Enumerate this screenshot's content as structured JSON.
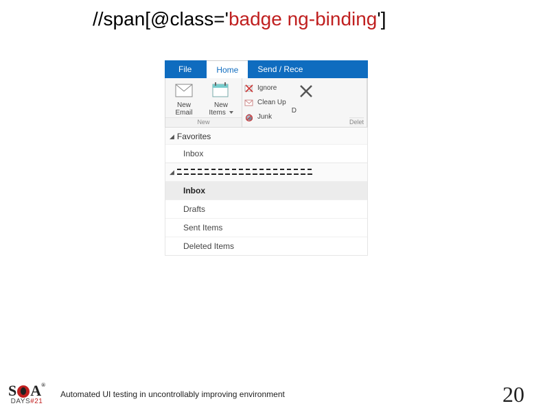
{
  "title": {
    "part1": "//span[@class='",
    "part2": "badge ng-binding",
    "part3": "']"
  },
  "outlook": {
    "tabs": {
      "file": "File",
      "home": "Home",
      "sendrecv": "Send / Rece"
    },
    "new_group": {
      "label": "New",
      "new_email": "New\nEmail",
      "new_items": "New\nItems "
    },
    "delete_group": {
      "label": "Delet",
      "ignore": "Ignore",
      "cleanup": "Clean Up ",
      "junk": "Junk ",
      "delete_trunc": "D"
    },
    "nav": {
      "favorites": "Favorites",
      "inbox_fav": "Inbox",
      "inbox": "Inbox",
      "drafts": "Drafts",
      "sent": "Sent Items",
      "deleted": "Deleted Items"
    }
  },
  "footer": {
    "logo_top_s": "S",
    "logo_top_a": "A",
    "logo_bottom_days": "DAYS",
    "logo_bottom_hash": "#21",
    "caption": "Automated UI testing in uncontrollably improving environment",
    "page": "20"
  }
}
